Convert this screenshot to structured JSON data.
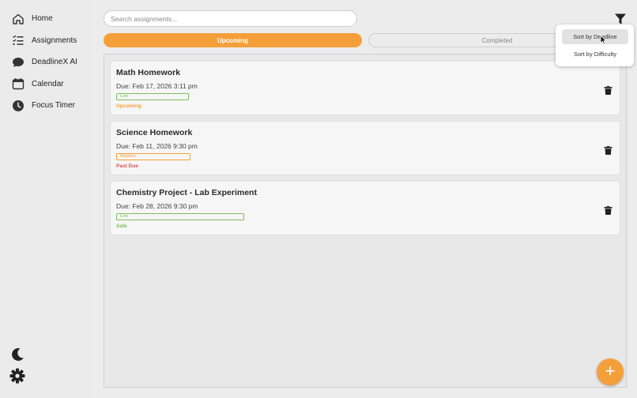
{
  "sidebar": {
    "items": [
      {
        "label": "Home",
        "icon": "home-icon"
      },
      {
        "label": "Assignments",
        "icon": "list-icon"
      },
      {
        "label": "DeadlineX AI",
        "icon": "chat-icon"
      },
      {
        "label": "Calendar",
        "icon": "calendar-icon"
      },
      {
        "label": "Focus Timer",
        "icon": "clock-icon"
      }
    ],
    "bottom_icons": [
      "moon-icon",
      "gear-icon"
    ]
  },
  "search": {
    "placeholder": "Search assignments..."
  },
  "tabs": [
    {
      "label": "Upcoming",
      "active": true
    },
    {
      "label": "Completed",
      "active": false
    }
  ],
  "sort_menu": {
    "items": [
      {
        "label": "Sort by Deadline",
        "selected": true
      },
      {
        "label": "Sort by Difficulty",
        "selected": false
      }
    ]
  },
  "assignments": [
    {
      "title": "Math Homework",
      "due": "Due: Feb 17, 2026 3:11 pm",
      "difficulty": "Low",
      "status": "Upcoming"
    },
    {
      "title": "Science Homework",
      "due": "Due: Feb 11, 2026 9:30 pm",
      "difficulty": "Medium",
      "status": "Past Due"
    },
    {
      "title": "Chemistry Project - Lab Experiment",
      "due": "Due: Feb 28, 2026 9:30 pm",
      "difficulty": "Low",
      "status": "Safe"
    }
  ],
  "fab": {
    "label": "+"
  },
  "colors": {
    "accent": "#f59f3a",
    "low": "#7cbf5c",
    "medium": "#f59f3a",
    "past_due": "#d9534f",
    "safe": "#7cbf5c"
  }
}
